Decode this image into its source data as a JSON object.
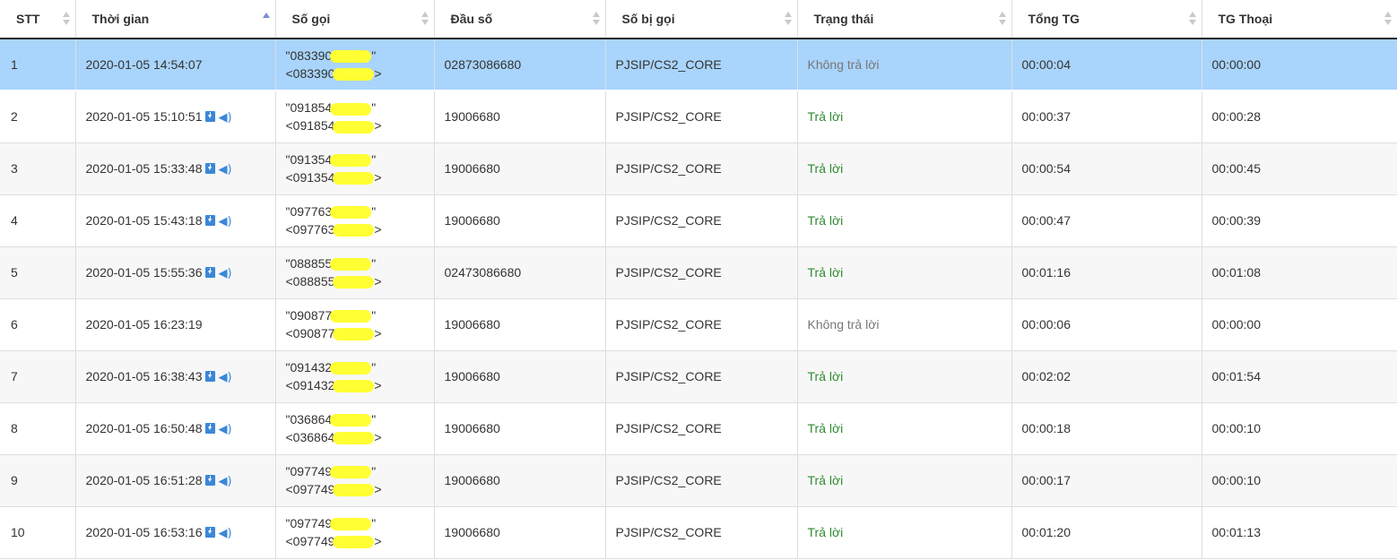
{
  "headers": [
    {
      "label": "STT",
      "sort": "none"
    },
    {
      "label": "Thời gian",
      "sort": "asc"
    },
    {
      "label": "Số gọi",
      "sort": "none"
    },
    {
      "label": "Đầu số",
      "sort": "none"
    },
    {
      "label": "Số bị gọi",
      "sort": "none"
    },
    {
      "label": "Trạng thái",
      "sort": "none"
    },
    {
      "label": "Tổng TG",
      "sort": "none"
    },
    {
      "label": "TG Thoại",
      "sort": "none"
    }
  ],
  "rows": [
    {
      "stt": "1",
      "time": "2020-01-05 14:54:07",
      "has_recording": false,
      "caller_line1": "\"083390",
      "caller_line1_end": "\"",
      "caller_line2": "<083390",
      "caller_line2_end": ">",
      "dau_so": "02873086680",
      "so_bi_goi": "PJSIP/CS2_CORE",
      "status": "Không trả lời",
      "tong_tg": "00:00:04",
      "tg_thoai": "00:00:00"
    },
    {
      "stt": "2",
      "time": "2020-01-05 15:10:51",
      "has_recording": true,
      "caller_line1": "\"091854",
      "caller_line1_end": "\"",
      "caller_line2": "<091854",
      "caller_line2_end": ">",
      "dau_so": "19006680",
      "so_bi_goi": "PJSIP/CS2_CORE",
      "status": "Trả lời",
      "tong_tg": "00:00:37",
      "tg_thoai": "00:00:28"
    },
    {
      "stt": "3",
      "time": "2020-01-05 15:33:48",
      "has_recording": true,
      "caller_line1": "\"091354",
      "caller_line1_end": "\"",
      "caller_line2": "<091354",
      "caller_line2_end": ">",
      "dau_so": "19006680",
      "so_bi_goi": "PJSIP/CS2_CORE",
      "status": "Trả lời",
      "tong_tg": "00:00:54",
      "tg_thoai": "00:00:45"
    },
    {
      "stt": "4",
      "time": "2020-01-05 15:43:18",
      "has_recording": true,
      "caller_line1": "\"097763",
      "caller_line1_end": "\"",
      "caller_line2": "<097763",
      "caller_line2_end": ">",
      "dau_so": "19006680",
      "so_bi_goi": "PJSIP/CS2_CORE",
      "status": "Trả lời",
      "tong_tg": "00:00:47",
      "tg_thoai": "00:00:39"
    },
    {
      "stt": "5",
      "time": "2020-01-05 15:55:36",
      "has_recording": true,
      "caller_line1": "\"088855",
      "caller_line1_end": "\"",
      "caller_line2": "<088855",
      "caller_line2_end": ">",
      "dau_so": "02473086680",
      "so_bi_goi": "PJSIP/CS2_CORE",
      "status": "Trả lời",
      "tong_tg": "00:01:16",
      "tg_thoai": "00:01:08"
    },
    {
      "stt": "6",
      "time": "2020-01-05 16:23:19",
      "has_recording": false,
      "caller_line1": "\"090877",
      "caller_line1_end": "\"",
      "caller_line2": "<090877",
      "caller_line2_end": ">",
      "dau_so": "19006680",
      "so_bi_goi": "PJSIP/CS2_CORE",
      "status": "Không trả lời",
      "tong_tg": "00:00:06",
      "tg_thoai": "00:00:00"
    },
    {
      "stt": "7",
      "time": "2020-01-05 16:38:43",
      "has_recording": true,
      "caller_line1": "\"091432",
      "caller_line1_end": "\"",
      "caller_line2": "<091432",
      "caller_line2_end": ">",
      "dau_so": "19006680",
      "so_bi_goi": "PJSIP/CS2_CORE",
      "status": "Trả lời",
      "tong_tg": "00:02:02",
      "tg_thoai": "00:01:54"
    },
    {
      "stt": "8",
      "time": "2020-01-05 16:50:48",
      "has_recording": true,
      "caller_line1": "\"036864",
      "caller_line1_end": "\"",
      "caller_line2": "<036864",
      "caller_line2_end": ">",
      "dau_so": "19006680",
      "so_bi_goi": "PJSIP/CS2_CORE",
      "status": "Trả lời",
      "tong_tg": "00:00:18",
      "tg_thoai": "00:00:10"
    },
    {
      "stt": "9",
      "time": "2020-01-05 16:51:28",
      "has_recording": true,
      "caller_line1": "\"097749",
      "caller_line1_end": "\"",
      "caller_line2": "<097749",
      "caller_line2_end": ">",
      "dau_so": "19006680",
      "so_bi_goi": "PJSIP/CS2_CORE",
      "status": "Trả lời",
      "tong_tg": "00:00:17",
      "tg_thoai": "00:00:10"
    },
    {
      "stt": "10",
      "time": "2020-01-05 16:53:16",
      "has_recording": true,
      "caller_line1": "\"097749",
      "caller_line1_end": "\"",
      "caller_line2": "<097749",
      "caller_line2_end": ">",
      "dau_so": "19006680",
      "so_bi_goi": "PJSIP/CS2_CORE",
      "status": "Trả lời",
      "tong_tg": "00:01:20",
      "tg_thoai": "00:01:13"
    }
  ],
  "selected_row": 0,
  "icons": {
    "download": "download-icon",
    "sound": "speaker-icon",
    "sort": "sort-icon"
  },
  "colors": {
    "selected_row": "#a9d4fb",
    "answered": "#2f8a2f",
    "missed": "#777777",
    "mask": "#ffff33",
    "icon": "#3a87d9"
  }
}
